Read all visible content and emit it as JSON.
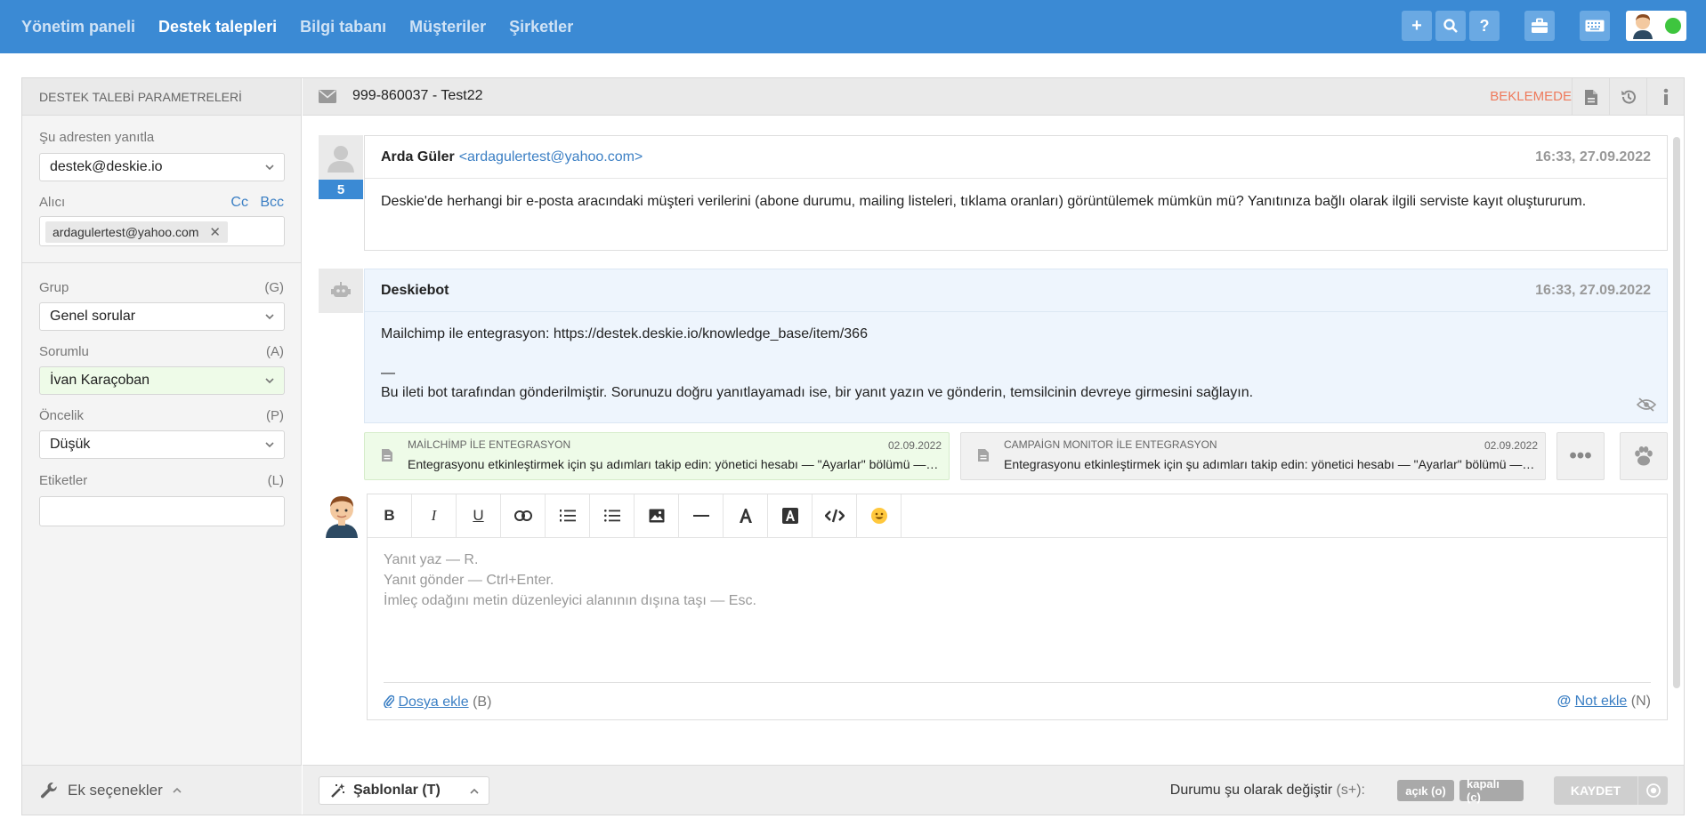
{
  "nav": {
    "items": [
      "Yönetim paneli",
      "Destek talepleri",
      "Bilgi tabanı",
      "Müşteriler",
      "Şirketler"
    ]
  },
  "sidebar": {
    "title": "DESTEK TALEBİ PARAMETRELERİ",
    "reply_from_label": "Şu adresten yanıtla",
    "reply_from_value": "destek@deskie.io",
    "recipient_label": "Alıcı",
    "cc": "Cc",
    "bcc": "Bcc",
    "recipient_chip": "ardagulertest@yahoo.com",
    "group_label": "Grup",
    "group_key": "(G)",
    "group_value": "Genel sorular",
    "assignee_label": "Sorumlu",
    "assignee_key": "(A)",
    "assignee_value": "İvan Karaçoban",
    "priority_label": "Öncelik",
    "priority_key": "(P)",
    "priority_value": "Düşük",
    "tags_label": "Etiketler",
    "tags_key": "(L)",
    "tags_value": "",
    "footer_label": "Ek seçenekler"
  },
  "ticket": {
    "id_title": "999-860037 - Test22",
    "status": "BEKLEMEDE"
  },
  "messages": [
    {
      "author": "Arda Güler",
      "email": "<ardagulertest@yahoo.com>",
      "time": "16:33, 27.09.2022",
      "count": "5",
      "body": "Deskie'de herhangi bir e-posta aracındaki müşteri verilerini (abone durumu, mailing listeleri, tıklama oranları) görüntülemek mümkün mü? Yanıtınıza bağlı olarak ilgili serviste kayıt oluştururum."
    },
    {
      "author": "Deskiebot",
      "time": "16:33, 27.09.2022",
      "line1": "Mailchimp ile entegrasyon: https://destek.deskie.io/knowledge_base/item/366",
      "line2": "—",
      "line3": "Bu ileti bot tarafından gönderilmiştir. Sorunuzu doğru yanıtlayamadı ise, bir yanıt yazın ve gönderin, temsilcinin devreye girmesini sağlayın."
    }
  ],
  "kb_suggestions": [
    {
      "title": "MAİLCHİMP İLE ENTEGRASYON",
      "date": "02.09.2022",
      "text": "Entegrasyonu etkinleştirmek için şu adımları takip edin: yönetici hesabı — \"Ayarlar\" bölümü — \"Entegrasyonlar\""
    },
    {
      "title": "CAMPAİGN MONITOR İLE ENTEGRASYON",
      "date": "02.09.2022",
      "text": "Entegrasyonu etkinleştirmek için şu adımları takip edin: yönetici hesabı — \"Ayarlar\" bölümü — \"Entegrasyonlar\""
    }
  ],
  "editor": {
    "toolbar": [
      "B",
      "I",
      "U"
    ],
    "ph1": "Yanıt yaz — R.",
    "ph2": "Yanıt gönder — Ctrl+Enter.",
    "ph3": "İmleç odağını metin düzenleyici alanının dışına taşı — Esc.",
    "attach_link": "Dosya ekle",
    "attach_key": "(B)",
    "note_link": "Not ekle",
    "note_key": "(N)"
  },
  "footer": {
    "templates": "Şablonlar (T)",
    "change_label": "Durumu şu olarak değiştir",
    "change_key": "(s+):",
    "open_btn": "açık (o)",
    "closed_btn": "kapalı (c)",
    "save": "KAYDET"
  },
  "colors": {
    "brand": "#3b8ad4",
    "status": "#ef7a5c",
    "link": "#3b7fc4"
  }
}
